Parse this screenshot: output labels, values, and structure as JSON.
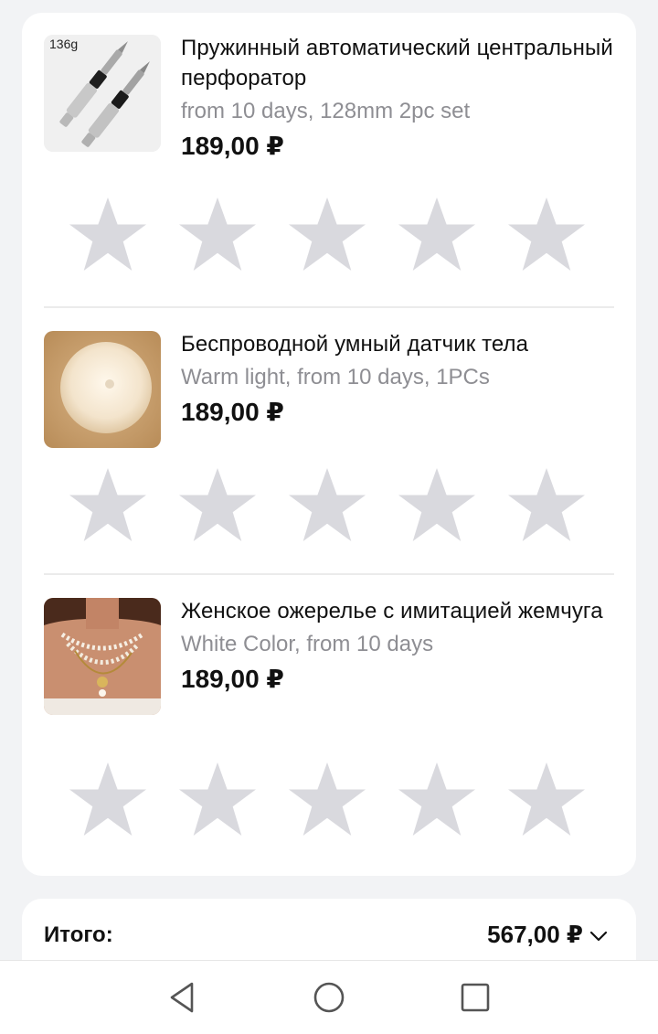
{
  "items": [
    {
      "title": "Пружинный автоматический центральный перфоратор",
      "variant": "from 10 days, 128mm 2pc set",
      "price": "189,00 ₽",
      "image_icon": "spring-center-punch-photo",
      "image_badge": "136g",
      "rating": 0,
      "max_rating": 5
    },
    {
      "title": "Беспроводной умный датчик тела",
      "variant": "Warm light, from 10 days, 1PCs",
      "price": "189,00 ₽",
      "image_icon": "motion-sensor-light-photo",
      "rating": 0,
      "max_rating": 5
    },
    {
      "title": "Женское ожерелье с имитацией жемчуга",
      "variant": "White Color, from 10 days",
      "price": "189,00 ₽",
      "image_icon": "pearl-necklace-photo",
      "rating": 0,
      "max_rating": 5
    }
  ],
  "total": {
    "label": "Итого:",
    "value": "567,00 ₽",
    "icon": "chevron-down-icon"
  },
  "navbar": {
    "back_icon": "back-triangle-icon",
    "home_icon": "home-circle-icon",
    "recents_icon": "recents-square-icon"
  },
  "colors": {
    "star_empty": "#d9d9de",
    "background": "#f2f3f5",
    "card": "#ffffff",
    "secondary_text": "#8e8e93"
  }
}
